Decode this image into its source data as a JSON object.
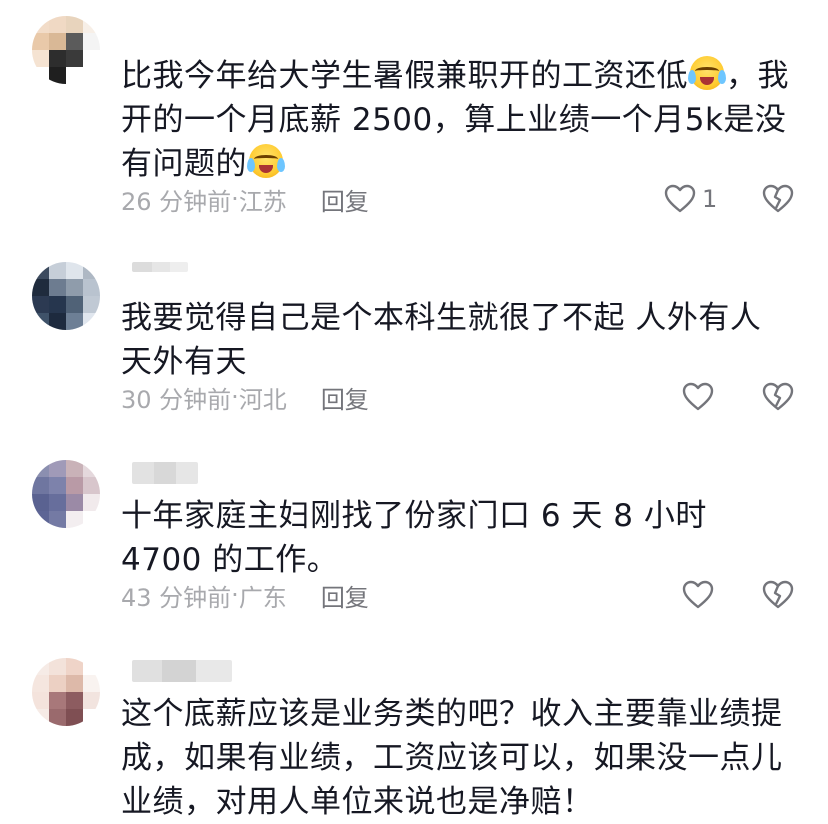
{
  "comments": [
    {
      "text_a": "比我今年给大学生暑假兼职开的工资还低",
      "emoji1": "crying-laughing-emoji",
      "text_b": "，我开的一个月底薪 2500，算上业绩一个月5k是没有问题的",
      "emoji2": "crying-laughing-emoji",
      "time": "26 分钟前",
      "location": "江苏",
      "reply": "回复",
      "likes": "1"
    },
    {
      "text": "我要觉得自己是个本科生就很了不起 人外有人 天外有天",
      "time": "30 分钟前",
      "location": "河北",
      "reply": "回复"
    },
    {
      "text": "十年家庭主妇刚找了份家门口 6 天 8 小时 4700 的工作。",
      "time": "43 分钟前",
      "location": "广东",
      "reply": "回复"
    },
    {
      "text": "这个底薪应该是业务类的吧？收入主要靠业绩提成，如果有业绩，工资应该可以，如果没一点儿业绩，对用人单位来说也是净赔！"
    }
  ],
  "separator": " · ",
  "icons": {
    "like": "heart-outline-icon",
    "dislike": "broken-heart-icon"
  },
  "colors": {
    "text": "#161823",
    "meta": "#a8a9ad",
    "icon": "#74757b"
  }
}
